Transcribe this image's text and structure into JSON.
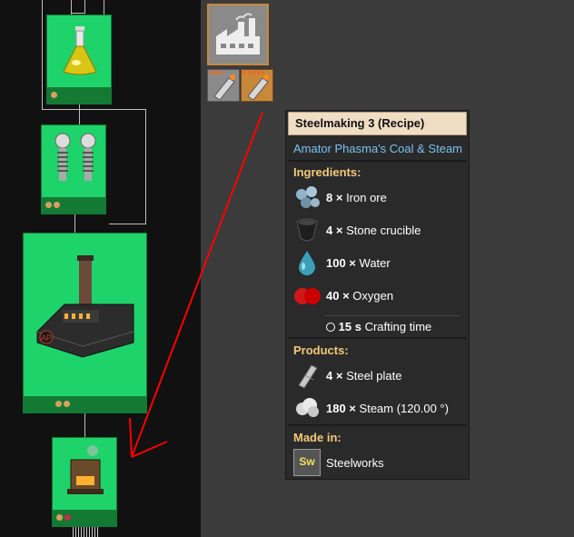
{
  "tooltip": {
    "title": "Steelmaking 3 (Recipe)",
    "mod": "Amator Phasma's Coal & Steam",
    "ingredients_label": "Ingredients:",
    "ingredients": [
      {
        "amount": "8 ×",
        "name": "Iron ore",
        "icon": "iron-ore-icon"
      },
      {
        "amount": "4 ×",
        "name": "Stone crucible",
        "icon": "stone-crucible-icon"
      },
      {
        "amount": "100 ×",
        "name": "Water",
        "icon": "water-icon"
      },
      {
        "amount": "40 ×",
        "name": "Oxygen",
        "icon": "oxygen-icon"
      }
    ],
    "crafting_time": {
      "value": "15 s",
      "label": "Crafting time",
      "icon": "clock-icon"
    },
    "products_label": "Products:",
    "products": [
      {
        "amount": "4 ×",
        "name": "Steel plate",
        "icon": "steel-plate-icon"
      },
      {
        "amount": "180 ×",
        "name": "Steam (120.00 °)",
        "icon": "steam-icon"
      }
    ],
    "made_in_label": "Made in:",
    "made_in": {
      "name": "Steelworks",
      "icon_text": "Sw",
      "icon": "steelworks-icon"
    }
  },
  "colors": {
    "node_green": "#1fd36b",
    "node_footer": "#147a33",
    "tooltip_title_bg": "#f1ddc3",
    "section_label": "#f3c97a",
    "mod_name": "#7ac3f0",
    "arrow": "#ff0000"
  },
  "tree_icons": [
    "flask-icon",
    "electrode-icon",
    "steelworks-machine-icon",
    "furnace-icon"
  ]
}
